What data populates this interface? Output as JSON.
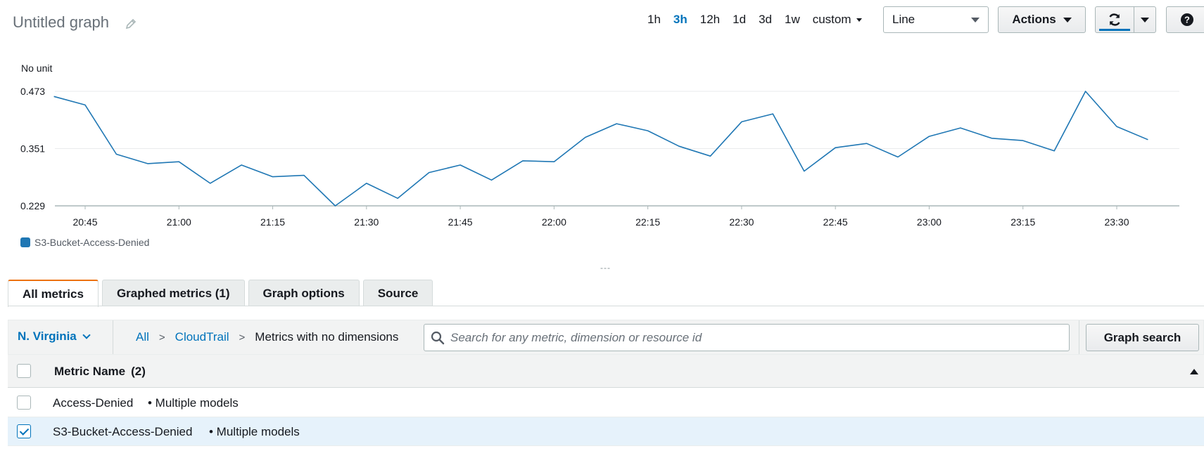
{
  "header": {
    "title": "Untitled graph",
    "ranges": [
      "1h",
      "3h",
      "12h",
      "1d",
      "3d",
      "1w"
    ],
    "active_range": "3h",
    "custom_label": "custom",
    "graph_type": "Line",
    "actions_label": "Actions",
    "help_label": "?"
  },
  "chart_data": {
    "type": "line",
    "unit_label": "No unit",
    "ylim": [
      0.229,
      0.473
    ],
    "yticks": [
      "0.473",
      "0.351",
      "0.229"
    ],
    "xtick_labels": [
      "20:45",
      "21:00",
      "21:15",
      "21:30",
      "21:45",
      "22:00",
      "22:15",
      "22:30",
      "22:45",
      "23:00",
      "23:15",
      "23:30"
    ],
    "x": [
      "20:40",
      "20:45",
      "20:50",
      "20:55",
      "21:00",
      "21:05",
      "21:10",
      "21:15",
      "21:20",
      "21:25",
      "21:30",
      "21:35",
      "21:40",
      "21:45",
      "21:50",
      "21:55",
      "22:00",
      "22:05",
      "22:10",
      "22:15",
      "22:20",
      "22:25",
      "22:30",
      "22:35",
      "22:40",
      "22:45",
      "22:50",
      "22:55",
      "23:00",
      "23:05",
      "23:10",
      "23:15",
      "23:20",
      "23:25",
      "23:30",
      "23:35"
    ],
    "series": [
      {
        "name": "S3-Bucket-Access-Denied",
        "color": "#1f77b4",
        "values": [
          0.462,
          0.444,
          0.339,
          0.319,
          0.323,
          0.277,
          0.316,
          0.291,
          0.294,
          0.229,
          0.277,
          0.245,
          0.3,
          0.316,
          0.284,
          0.325,
          0.323,
          0.375,
          0.404,
          0.389,
          0.356,
          0.335,
          0.408,
          0.425,
          0.303,
          0.353,
          0.362,
          0.333,
          0.377,
          0.395,
          0.373,
          0.368,
          0.346,
          0.473,
          0.398,
          0.37
        ]
      }
    ],
    "grid": true
  },
  "resize_handle": "---",
  "tabs": [
    {
      "label": "All metrics"
    },
    {
      "label": "Graphed metrics (1)"
    },
    {
      "label": "Graph options"
    },
    {
      "label": "Source"
    }
  ],
  "browse": {
    "region": "N. Virginia",
    "crumbs": [
      "All",
      "CloudTrail"
    ],
    "current": "Metrics with no dimensions",
    "search_placeholder": "Search for any metric, dimension or resource id",
    "graph_search_label": "Graph search"
  },
  "table": {
    "header_label": "Metric Name",
    "header_count": "(2)",
    "rows": [
      {
        "name": "Access-Denied",
        "meta": "• Multiple models",
        "checked": false
      },
      {
        "name": "S3-Bucket-Access-Denied",
        "meta": "• Multiple models",
        "checked": true
      }
    ]
  }
}
